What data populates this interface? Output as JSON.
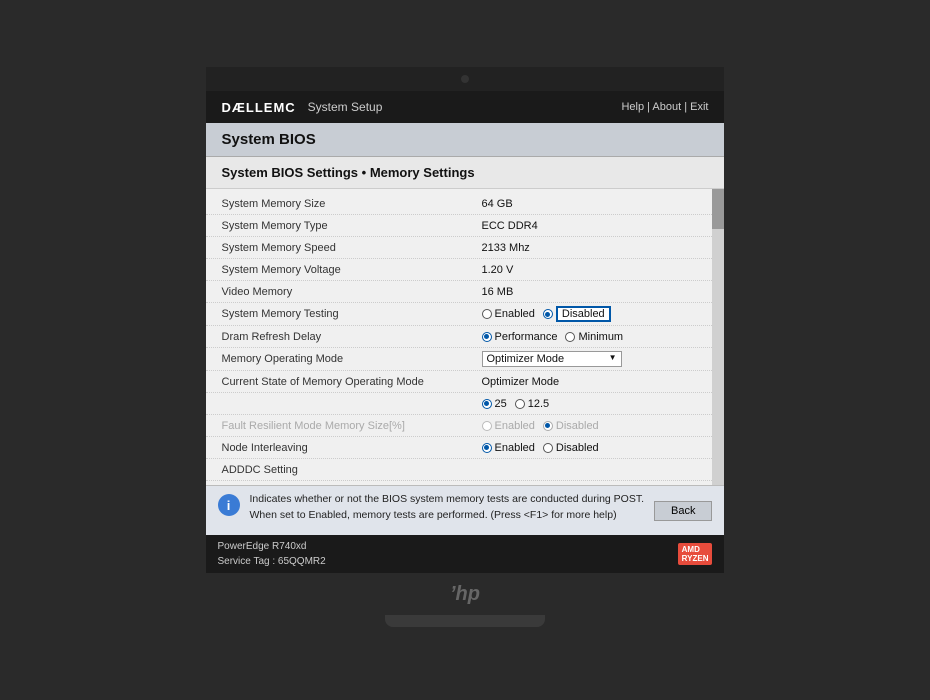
{
  "header": {
    "brand": "DÆLLEMC",
    "brand_bold": "DÆLL",
    "brand_rest": "EMC",
    "system_setup_label": "System Setup",
    "help_label": "Help | About | Exit"
  },
  "page": {
    "title": "System BIOS",
    "section": "System BIOS Settings • Memory Settings"
  },
  "settings": [
    {
      "label": "System Memory Size",
      "value": "64 GB",
      "type": "text"
    },
    {
      "label": "System Memory Type",
      "value": "ECC DDR4",
      "type": "text"
    },
    {
      "label": "System Memory Speed",
      "value": "2133 Mhz",
      "type": "text"
    },
    {
      "label": "System Memory Voltage",
      "value": "1.20 V",
      "type": "text"
    },
    {
      "label": "Video Memory",
      "value": "16 MB",
      "type": "text"
    },
    {
      "label": "System Memory Testing",
      "type": "radio",
      "options": [
        {
          "label": "Enabled",
          "selected": false
        },
        {
          "label": "Disabled",
          "selected": true,
          "boxed": true
        }
      ]
    },
    {
      "label": "Dram Refresh Delay",
      "type": "radio",
      "options": [
        {
          "label": "Performance",
          "selected": true
        },
        {
          "label": "Minimum",
          "selected": false
        }
      ]
    },
    {
      "label": "Memory Operating Mode",
      "type": "dropdown",
      "value": "Optimizer Mode"
    },
    {
      "label": "Current State of Memory Operating Mode",
      "type": "text",
      "value": "Optimizer Mode"
    },
    {
      "label": "",
      "type": "radio-25",
      "options": [
        {
          "label": "25",
          "selected": true
        },
        {
          "label": "12.5",
          "selected": false
        }
      ]
    },
    {
      "label": "Fault Resilient Mode Memory Size[%]",
      "type": "radio-disabled",
      "options": [
        {
          "label": "Enabled",
          "selected": false,
          "grayed": true
        },
        {
          "label": "Disabled",
          "selected": true,
          "grayed": true
        }
      ]
    },
    {
      "label": "Node Interleaving",
      "type": "radio",
      "options": [
        {
          "label": "Enabled",
          "selected": true
        },
        {
          "label": "Disabled",
          "selected": false
        }
      ]
    },
    {
      "label": "ADDDC Setting",
      "value": "",
      "type": "text"
    }
  ],
  "info": {
    "icon": "i",
    "text1": "Indicates whether or not the BIOS system memory tests are conducted during POST.",
    "text2": "When set to Enabled, memory tests are performed. (Press <F1> for more help)"
  },
  "footer": {
    "model": "PowerEdge R740xd",
    "service_tag_label": "Service Tag : 65QQMR2",
    "back_label": "Back"
  }
}
